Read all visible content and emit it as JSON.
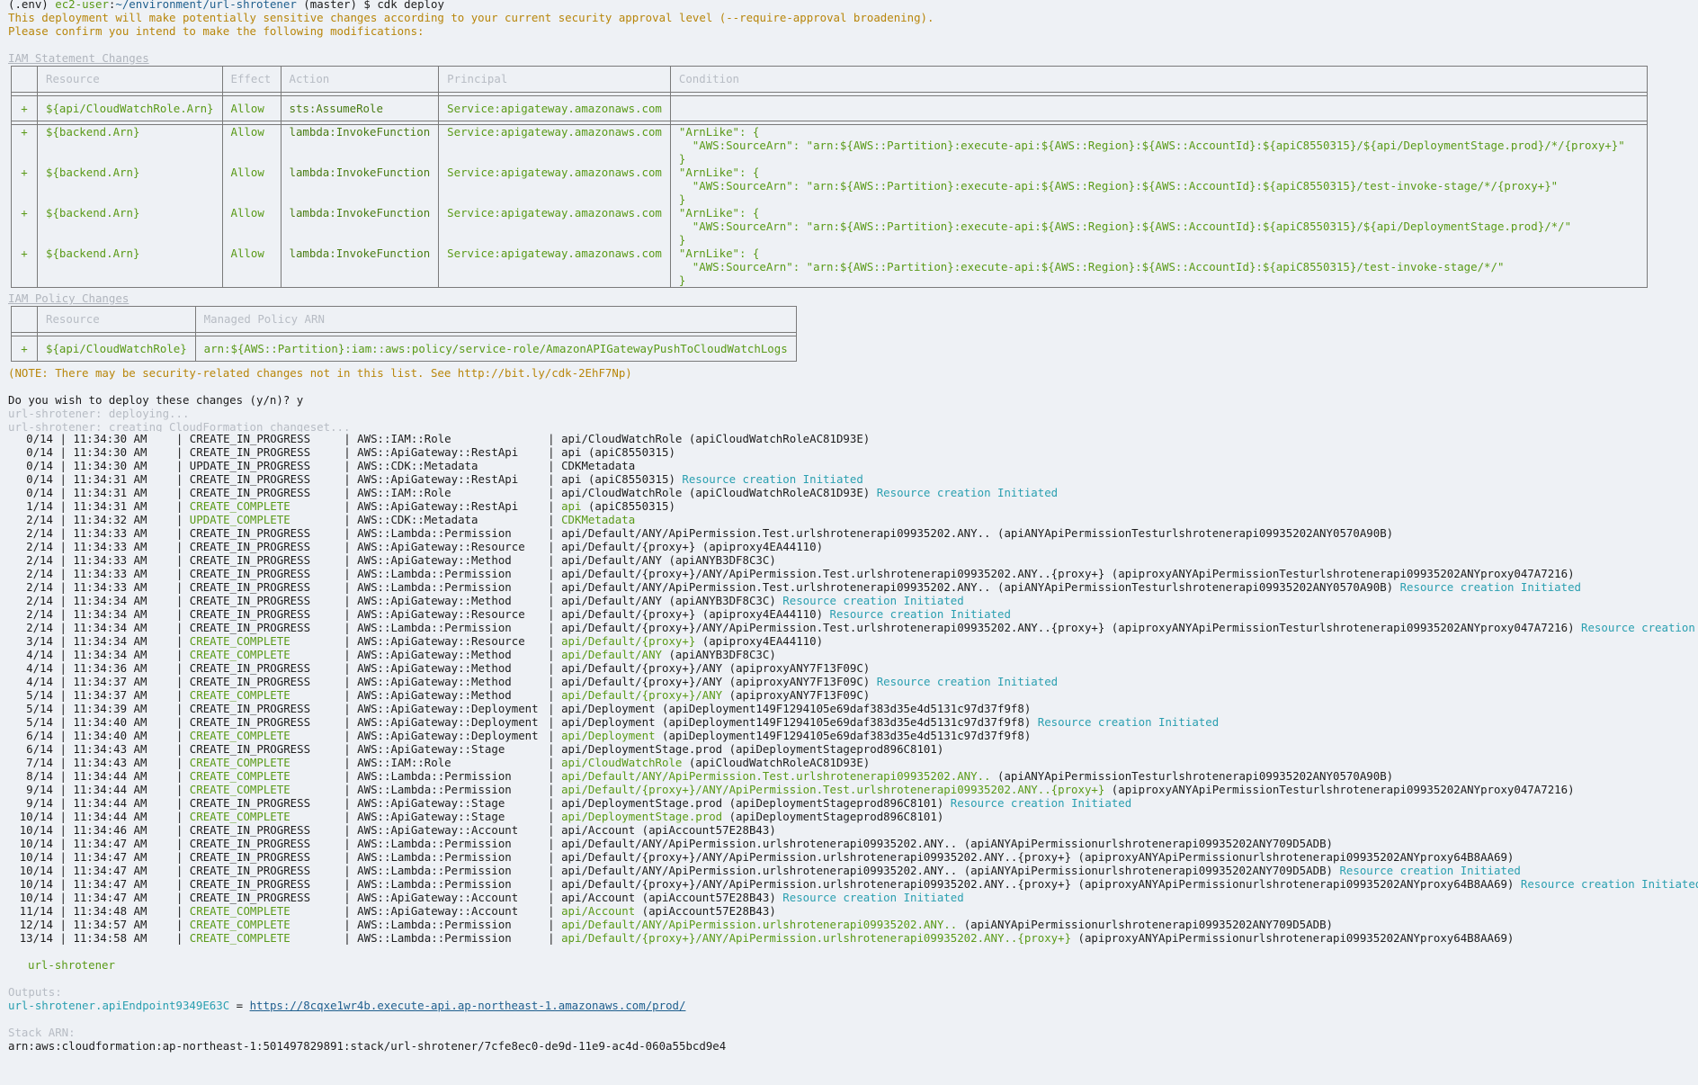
{
  "prompt_line": {
    "env": "(.env)",
    "user_host": "ec2-user",
    "sep": ":",
    "path": "~/environment/url-shrotener",
    "branch": " (master) $ ",
    "command": "cdk deploy"
  },
  "warning_lines": [
    "This deployment will make potentially sensitive changes according to your current security approval level (--require-approval broadening).",
    "Please confirm you intend to make the following modifications:"
  ],
  "iam_statement": {
    "heading": "IAM Statement Changes",
    "headers": [
      "",
      "Resource",
      "Effect",
      "Action",
      "Principal",
      "Condition"
    ],
    "rows": [
      {
        "sign": "+",
        "resource": "${api/CloudWatchRole.Arn}",
        "effect": "Allow",
        "action": "sts:AssumeRole",
        "principal": "Service:apigateway.amazonaws.com",
        "condition": ""
      },
      {
        "sign": "+",
        "resource": "${backend.Arn}",
        "effect": "Allow",
        "action": "lambda:InvokeFunction",
        "principal": "Service:apigateway.amazonaws.com",
        "condition": "\"ArnLike\": {\n  \"AWS:SourceArn\": \"arn:${AWS::Partition}:execute-api:${AWS::Region}:${AWS::AccountId}:${apiC8550315}/${api/DeploymentStage.prod}/*/{proxy+}\"\n}"
      },
      {
        "sign": "+",
        "resource": "${backend.Arn}",
        "effect": "Allow",
        "action": "lambda:InvokeFunction",
        "principal": "Service:apigateway.amazonaws.com",
        "condition": "\"ArnLike\": {\n  \"AWS:SourceArn\": \"arn:${AWS::Partition}:execute-api:${AWS::Region}:${AWS::AccountId}:${apiC8550315}/test-invoke-stage/*/{proxy+}\"\n}"
      },
      {
        "sign": "+",
        "resource": "${backend.Arn}",
        "effect": "Allow",
        "action": "lambda:InvokeFunction",
        "principal": "Service:apigateway.amazonaws.com",
        "condition": "\"ArnLike\": {\n  \"AWS:SourceArn\": \"arn:${AWS::Partition}:execute-api:${AWS::Region}:${AWS::AccountId}:${apiC8550315}/${api/DeploymentStage.prod}/*/\"\n}"
      },
      {
        "sign": "+",
        "resource": "${backend.Arn}",
        "effect": "Allow",
        "action": "lambda:InvokeFunction",
        "principal": "Service:apigateway.amazonaws.com",
        "condition": "\"ArnLike\": {\n  \"AWS:SourceArn\": \"arn:${AWS::Partition}:execute-api:${AWS::Region}:${AWS::AccountId}:${apiC8550315}/test-invoke-stage/*/\"\n}"
      }
    ]
  },
  "iam_policy": {
    "heading": "IAM Policy Changes",
    "headers": [
      "",
      "Resource",
      "Managed Policy ARN"
    ],
    "rows": [
      {
        "sign": "+",
        "resource": "${api/CloudWatchRole}",
        "arn": "arn:${AWS::Partition}:iam::aws:policy/service-role/AmazonAPIGatewayPushToCloudWatchLogs"
      }
    ]
  },
  "note": "(NOTE: There may be security-related changes not in this list. See http://bit.ly/cdk-2EhF7Np)",
  "confirm": "Do you wish to deploy these changes (y/n)? y",
  "status_lines": [
    {
      "stack": "url-shrotener",
      "text": ": deploying..."
    },
    {
      "stack": "url-shrotener",
      "text": ": creating CloudFormation changeset..."
    }
  ],
  "events": [
    {
      "progress": "0/14",
      "time": "11:34:30 AM",
      "status": "CREATE_IN_PROGRESS",
      "type": "AWS::IAM::Role",
      "logical": "api/CloudWatchRole",
      "physical": " (apiCloudWatchRoleAC81D93E)",
      "extra": ""
    },
    {
      "progress": "0/14",
      "time": "11:34:30 AM",
      "status": "CREATE_IN_PROGRESS",
      "type": "AWS::ApiGateway::RestApi",
      "logical": "api",
      "physical": " (apiC8550315)",
      "extra": ""
    },
    {
      "progress": "0/14",
      "time": "11:34:30 AM",
      "status": "UPDATE_IN_PROGRESS",
      "type": "AWS::CDK::Metadata",
      "logical": "CDKMetadata",
      "physical": "",
      "extra": ""
    },
    {
      "progress": "0/14",
      "time": "11:34:31 AM",
      "status": "CREATE_IN_PROGRESS",
      "type": "AWS::ApiGateway::RestApi",
      "logical": "api",
      "physical": " (apiC8550315)",
      "extra": " Resource creation Initiated"
    },
    {
      "progress": "0/14",
      "time": "11:34:31 AM",
      "status": "CREATE_IN_PROGRESS",
      "type": "AWS::IAM::Role",
      "logical": "api/CloudWatchRole",
      "physical": " (apiCloudWatchRoleAC81D93E)",
      "extra": " Resource creation Initiated"
    },
    {
      "progress": "1/14",
      "time": "11:34:31 AM",
      "status": "CREATE_COMPLETE",
      "type": "AWS::ApiGateway::RestApi",
      "logical": "api",
      "physical": " (apiC8550315)",
      "extra": ""
    },
    {
      "progress": "2/14",
      "time": "11:34:32 AM",
      "status": "UPDATE_COMPLETE",
      "type": "AWS::CDK::Metadata",
      "logical": "CDKMetadata",
      "physical": "",
      "extra": ""
    },
    {
      "progress": "2/14",
      "time": "11:34:33 AM",
      "status": "CREATE_IN_PROGRESS",
      "type": "AWS::Lambda::Permission",
      "logical": "api/Default/ANY/ApiPermission.Test.urlshrotenerapi09935202.ANY..",
      "physical": " (apiANYApiPermissionTesturlshrotenerapi09935202ANY0570A90B)",
      "extra": ""
    },
    {
      "progress": "2/14",
      "time": "11:34:33 AM",
      "status": "CREATE_IN_PROGRESS",
      "type": "AWS::ApiGateway::Resource",
      "logical": "api/Default/{proxy+}",
      "physical": " (apiproxy4EA44110)",
      "extra": ""
    },
    {
      "progress": "2/14",
      "time": "11:34:33 AM",
      "status": "CREATE_IN_PROGRESS",
      "type": "AWS::ApiGateway::Method",
      "logical": "api/Default/ANY",
      "physical": " (apiANYB3DF8C3C)",
      "extra": ""
    },
    {
      "progress": "2/14",
      "time": "11:34:33 AM",
      "status": "CREATE_IN_PROGRESS",
      "type": "AWS::Lambda::Permission",
      "logical": "api/Default/{proxy+}/ANY/ApiPermission.Test.urlshrotenerapi09935202.ANY..{proxy+}",
      "physical": " (apiproxyANYApiPermissionTesturlshrotenerapi09935202ANYproxy047A7216)",
      "extra": ""
    },
    {
      "progress": "2/14",
      "time": "11:34:33 AM",
      "status": "CREATE_IN_PROGRESS",
      "type": "AWS::Lambda::Permission",
      "logical": "api/Default/ANY/ApiPermission.Test.urlshrotenerapi09935202.ANY..",
      "physical": " (apiANYApiPermissionTesturlshrotenerapi09935202ANY0570A90B)",
      "extra": " Resource creation Initiated"
    },
    {
      "progress": "2/14",
      "time": "11:34:34 AM",
      "status": "CREATE_IN_PROGRESS",
      "type": "AWS::ApiGateway::Method",
      "logical": "api/Default/ANY",
      "physical": " (apiANYB3DF8C3C)",
      "extra": " Resource creation Initiated"
    },
    {
      "progress": "2/14",
      "time": "11:34:34 AM",
      "status": "CREATE_IN_PROGRESS",
      "type": "AWS::ApiGateway::Resource",
      "logical": "api/Default/{proxy+}",
      "physical": " (apiproxy4EA44110)",
      "extra": " Resource creation Initiated"
    },
    {
      "progress": "2/14",
      "time": "11:34:34 AM",
      "status": "CREATE_IN_PROGRESS",
      "type": "AWS::Lambda::Permission",
      "logical": "api/Default/{proxy+}/ANY/ApiPermission.Test.urlshrotenerapi09935202.ANY..{proxy+}",
      "physical": " (apiproxyANYApiPermissionTesturlshrotenerapi09935202ANYproxy047A7216)",
      "extra": " Resource creation Initiated"
    },
    {
      "progress": "3/14",
      "time": "11:34:34 AM",
      "status": "CREATE_COMPLETE",
      "type": "AWS::ApiGateway::Resource",
      "logical": "api/Default/{proxy+}",
      "physical": " (apiproxy4EA44110)",
      "extra": ""
    },
    {
      "progress": "4/14",
      "time": "11:34:34 AM",
      "status": "CREATE_COMPLETE",
      "type": "AWS::ApiGateway::Method",
      "logical": "api/Default/ANY",
      "physical": " (apiANYB3DF8C3C)",
      "extra": ""
    },
    {
      "progress": "4/14",
      "time": "11:34:36 AM",
      "status": "CREATE_IN_PROGRESS",
      "type": "AWS::ApiGateway::Method",
      "logical": "api/Default/{proxy+}/ANY",
      "physical": " (apiproxyANY7F13F09C)",
      "extra": ""
    },
    {
      "progress": "4/14",
      "time": "11:34:37 AM",
      "status": "CREATE_IN_PROGRESS",
      "type": "AWS::ApiGateway::Method",
      "logical": "api/Default/{proxy+}/ANY",
      "physical": " (apiproxyANY7F13F09C)",
      "extra": " Resource creation Initiated"
    },
    {
      "progress": "5/14",
      "time": "11:34:37 AM",
      "status": "CREATE_COMPLETE",
      "type": "AWS::ApiGateway::Method",
      "logical": "api/Default/{proxy+}/ANY",
      "physical": " (apiproxyANY7F13F09C)",
      "extra": ""
    },
    {
      "progress": "5/14",
      "time": "11:34:39 AM",
      "status": "CREATE_IN_PROGRESS",
      "type": "AWS::ApiGateway::Deployment",
      "logical": "api/Deployment",
      "physical": " (apiDeployment149F1294105e69daf383d35e4d5131c97d37f9f8)",
      "extra": ""
    },
    {
      "progress": "5/14",
      "time": "11:34:40 AM",
      "status": "CREATE_IN_PROGRESS",
      "type": "AWS::ApiGateway::Deployment",
      "logical": "api/Deployment",
      "physical": " (apiDeployment149F1294105e69daf383d35e4d5131c97d37f9f8)",
      "extra": " Resource creation Initiated"
    },
    {
      "progress": "6/14",
      "time": "11:34:40 AM",
      "status": "CREATE_COMPLETE",
      "type": "AWS::ApiGateway::Deployment",
      "logical": "api/Deployment",
      "physical": " (apiDeployment149F1294105e69daf383d35e4d5131c97d37f9f8)",
      "extra": ""
    },
    {
      "progress": "6/14",
      "time": "11:34:43 AM",
      "status": "CREATE_IN_PROGRESS",
      "type": "AWS::ApiGateway::Stage",
      "logical": "api/DeploymentStage.prod",
      "physical": " (apiDeploymentStageprod896C8101)",
      "extra": ""
    },
    {
      "progress": "7/14",
      "time": "11:34:43 AM",
      "status": "CREATE_COMPLETE",
      "type": "AWS::IAM::Role",
      "logical": "api/CloudWatchRole",
      "physical": " (apiCloudWatchRoleAC81D93E)",
      "extra": ""
    },
    {
      "progress": "8/14",
      "time": "11:34:44 AM",
      "status": "CREATE_COMPLETE",
      "type": "AWS::Lambda::Permission",
      "logical": "api/Default/ANY/ApiPermission.Test.urlshrotenerapi09935202.ANY..",
      "physical": " (apiANYApiPermissionTesturlshrotenerapi09935202ANY0570A90B)",
      "extra": ""
    },
    {
      "progress": "9/14",
      "time": "11:34:44 AM",
      "status": "CREATE_COMPLETE",
      "type": "AWS::Lambda::Permission",
      "logical": "api/Default/{proxy+}/ANY/ApiPermission.Test.urlshrotenerapi09935202.ANY..{proxy+}",
      "physical": " (apiproxyANYApiPermissionTesturlshrotenerapi09935202ANYproxy047A7216)",
      "extra": ""
    },
    {
      "progress": "9/14",
      "time": "11:34:44 AM",
      "status": "CREATE_IN_PROGRESS",
      "type": "AWS::ApiGateway::Stage",
      "logical": "api/DeploymentStage.prod",
      "physical": " (apiDeploymentStageprod896C8101)",
      "extra": " Resource creation Initiated"
    },
    {
      "progress": "10/14",
      "time": "11:34:44 AM",
      "status": "CREATE_COMPLETE",
      "type": "AWS::ApiGateway::Stage",
      "logical": "api/DeploymentStage.prod",
      "physical": " (apiDeploymentStageprod896C8101)",
      "extra": ""
    },
    {
      "progress": "10/14",
      "time": "11:34:46 AM",
      "status": "CREATE_IN_PROGRESS",
      "type": "AWS::ApiGateway::Account",
      "logical": "api/Account",
      "physical": " (apiAccount57E28B43)",
      "extra": ""
    },
    {
      "progress": "10/14",
      "time": "11:34:47 AM",
      "status": "CREATE_IN_PROGRESS",
      "type": "AWS::Lambda::Permission",
      "logical": "api/Default/ANY/ApiPermission.urlshrotenerapi09935202.ANY..",
      "physical": " (apiANYApiPermissionurlshrotenerapi09935202ANY709D5ADB)",
      "extra": ""
    },
    {
      "progress": "10/14",
      "time": "11:34:47 AM",
      "status": "CREATE_IN_PROGRESS",
      "type": "AWS::Lambda::Permission",
      "logical": "api/Default/{proxy+}/ANY/ApiPermission.urlshrotenerapi09935202.ANY..{proxy+}",
      "physical": " (apiproxyANYApiPermissionurlshrotenerapi09935202ANYproxy64B8AA69)",
      "extra": ""
    },
    {
      "progress": "10/14",
      "time": "11:34:47 AM",
      "status": "CREATE_IN_PROGRESS",
      "type": "AWS::Lambda::Permission",
      "logical": "api/Default/ANY/ApiPermission.urlshrotenerapi09935202.ANY..",
      "physical": " (apiANYApiPermissionurlshrotenerapi09935202ANY709D5ADB)",
      "extra": " Resource creation Initiated"
    },
    {
      "progress": "10/14",
      "time": "11:34:47 AM",
      "status": "CREATE_IN_PROGRESS",
      "type": "AWS::Lambda::Permission",
      "logical": "api/Default/{proxy+}/ANY/ApiPermission.urlshrotenerapi09935202.ANY..{proxy+}",
      "physical": " (apiproxyANYApiPermissionurlshrotenerapi09935202ANYproxy64B8AA69)",
      "extra": " Resource creation Initiated"
    },
    {
      "progress": "10/14",
      "time": "11:34:47 AM",
      "status": "CREATE_IN_PROGRESS",
      "type": "AWS::ApiGateway::Account",
      "logical": "api/Account",
      "physical": " (apiAccount57E28B43)",
      "extra": " Resource creation Initiated"
    },
    {
      "progress": "11/14",
      "time": "11:34:48 AM",
      "status": "CREATE_COMPLETE",
      "type": "AWS::ApiGateway::Account",
      "logical": "api/Account",
      "physical": " (apiAccount57E28B43)",
      "extra": ""
    },
    {
      "progress": "12/14",
      "time": "11:34:57 AM",
      "status": "CREATE_COMPLETE",
      "type": "AWS::Lambda::Permission",
      "logical": "api/Default/ANY/ApiPermission.urlshrotenerapi09935202.ANY..",
      "physical": " (apiANYApiPermissionurlshrotenerapi09935202ANY709D5ADB)",
      "extra": ""
    },
    {
      "progress": "13/14",
      "time": "11:34:58 AM",
      "status": "CREATE_COMPLETE",
      "type": "AWS::Lambda::Permission",
      "logical": "api/Default/{proxy+}/ANY/ApiPermission.urlshrotenerapi09935202.ANY..{proxy+}",
      "physical": " (apiproxyANYApiPermissionurlshrotenerapi09935202ANYproxy64B8AA69)",
      "extra": ""
    }
  ],
  "stack_done": "url-shrotener",
  "outputs_label": "Outputs:",
  "output": {
    "stack": "url-shrotener",
    "key": ".apiEndpoint9349E63C",
    "eq": " = ",
    "url": "https://8cqxe1wr4b.execute-api.ap-northeast-1.amazonaws.com/prod/"
  },
  "stack_arn_label": "Stack ARN:",
  "stack_arn": "arn:aws:cloudformation:ap-northeast-1:501497829891:stack/url-shrotener/7cfe8ec0-de9d-11e9-ac4d-060a55bcd9e4",
  "colors": {
    "background": "#eef1f5",
    "green": "#5a9a18",
    "gold": "#b8860b",
    "cyan": "#2a9fb0",
    "link": "#1f5f8e"
  }
}
